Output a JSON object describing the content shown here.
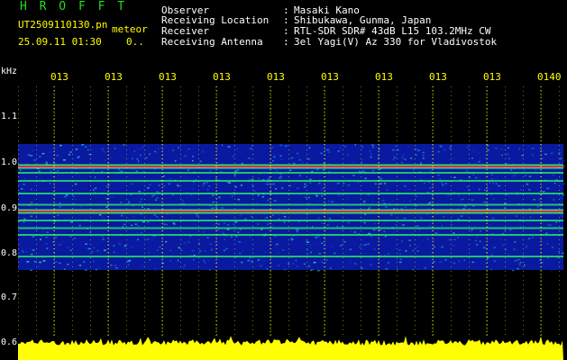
{
  "header": {
    "app_title": "H R O F F T",
    "filename": "UT2509110130.pn",
    "mode": "meteor",
    "datetime": "25.09.11 01:30",
    "counter": "0..",
    "fields": [
      {
        "label": "Observer",
        "sep": ":",
        "value": "Masaki Kano"
      },
      {
        "label": "Receiving Location",
        "sep": ":",
        "value": "Shibukawa, Gunma, Japan"
      },
      {
        "label": "Receiver",
        "sep": ":",
        "value": "RTL-SDR SDR# 43dB L15 103.2MHz CW"
      },
      {
        "label": "Receiving Antenna",
        "sep": ":",
        "value": "3el Yagi(V) Az 330 for Vladivostok"
      }
    ]
  },
  "axes": {
    "freq_unit": "kHz",
    "freq_ticks": [
      "1.1",
      "1.0",
      "0.9",
      "0.8",
      "0.7",
      "0.6"
    ],
    "time_ticks": [
      "013",
      "013",
      "013",
      "013",
      "013",
      "013",
      "013",
      "013",
      "013",
      "0140"
    ]
  },
  "spectrogram": {
    "freq_top_khz": 1.04,
    "freq_bottom_khz": 0.76,
    "strong_lines_khz": [
      0.99,
      0.89
    ],
    "medium_lines_khz": [
      0.976,
      0.958,
      0.93,
      0.905,
      0.87,
      0.853,
      0.838,
      0.79
    ],
    "colors": {
      "background": "#000000",
      "noise": "#0a1aa0",
      "strong": "#ff2060",
      "mid": "#20ff60",
      "level_bar": "#ffff00",
      "grid": "#ffff00"
    }
  }
}
